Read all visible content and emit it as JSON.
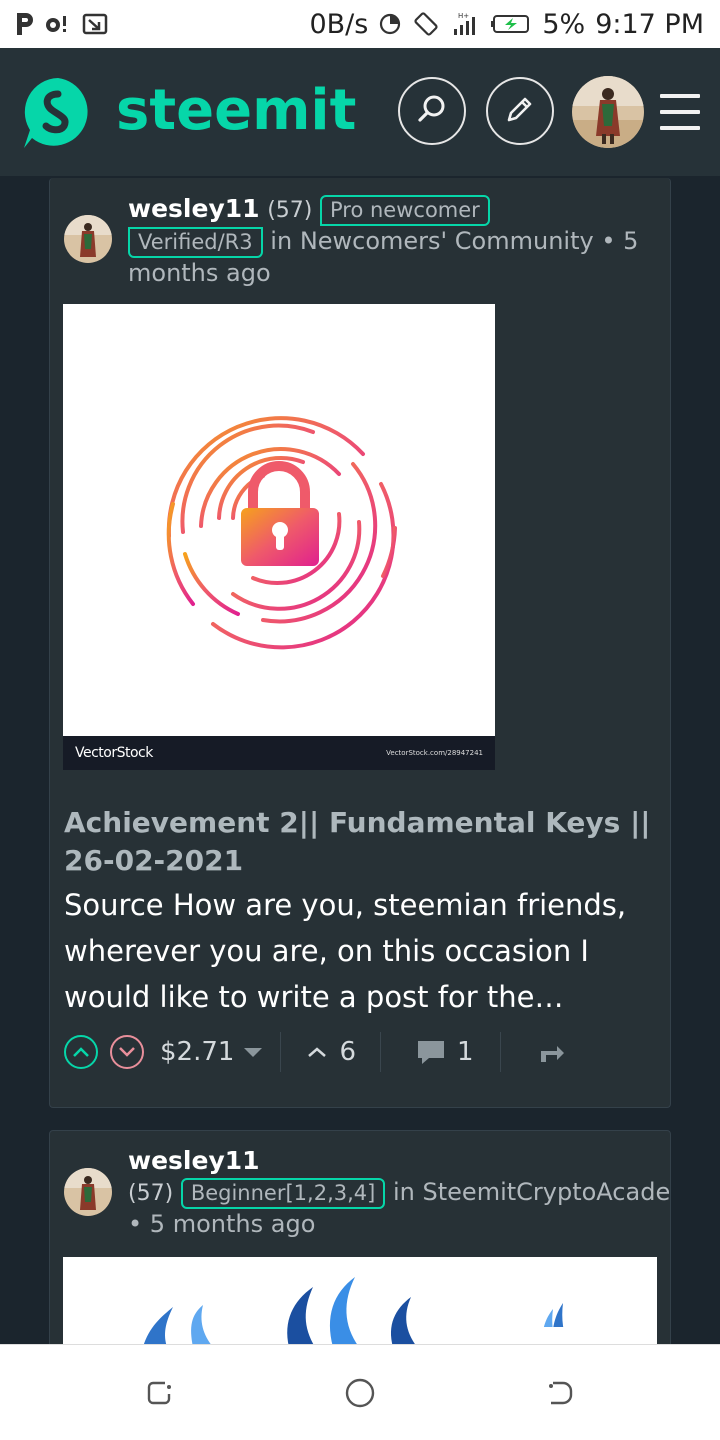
{
  "status_bar": {
    "net_speed": "0B/s",
    "battery": "5%",
    "time": "9:17 PM",
    "left_icons": [
      "p-app-icon",
      "voicemail-icon",
      "cast-icon"
    ],
    "right_icons": [
      "data-saver-icon",
      "rotate-icon",
      "signal-icon",
      "battery-charging-icon"
    ]
  },
  "header": {
    "brand": "steemit",
    "brand_color": "#06d6a9",
    "actions": [
      "search-icon",
      "pencil-icon",
      "avatar",
      "menu-icon"
    ]
  },
  "posts": [
    {
      "author": "wesley11",
      "reputation": "(57)",
      "badge": "Pro newcomer Verified/R3",
      "badge_line1": "Pro newcomer",
      "badge_line2": "Verified/R3",
      "in_text": "in",
      "community": "Newcomers' Community",
      "separator": "•",
      "time_first": "5",
      "time_rest": "months ago",
      "image_footer_left": "VectorStock",
      "image_footer_right": "VectorStock.com/28947241",
      "title": "Achievement 2|| Fundamental Keys || 26-02-2021",
      "summary": "Source How are you, steemian friends, wherever you are, on this occasion I would like to write a post for the…",
      "payout": "$2.71",
      "votes": "6",
      "comments": "1"
    },
    {
      "author": "wesley11",
      "reputation": "(57)",
      "badge": "Beginner[1,2,3,4]",
      "in_text": "in",
      "community": "SteemitCryptoAcademy",
      "separator": "•",
      "time_first": "5",
      "time_rest": "months ago"
    }
  ],
  "colors": {
    "background": "#1b252d",
    "card": "#273136",
    "accent": "#06d6a9",
    "downvote": "#e88f9b"
  }
}
